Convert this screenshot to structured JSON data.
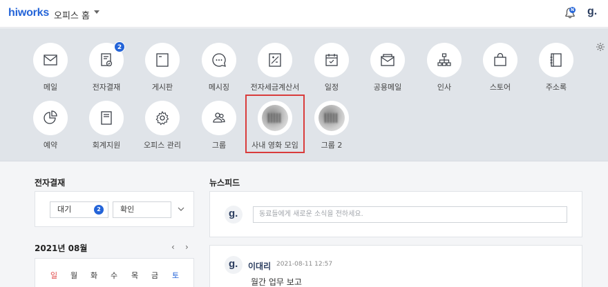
{
  "header": {
    "logo": "hiworks",
    "home_title": "오피스 홈",
    "bell_badge": "N",
    "user_logo": "g."
  },
  "apps": [
    {
      "label": "메일",
      "icon": "mail-icon"
    },
    {
      "label": "전자결재",
      "icon": "approval-icon",
      "badge": "2"
    },
    {
      "label": "게시판",
      "icon": "board-icon"
    },
    {
      "label": "메시징",
      "icon": "message-icon"
    },
    {
      "label": "전자세금계산서",
      "icon": "tax-invoice-icon"
    },
    {
      "label": "일정",
      "icon": "calendar-icon"
    },
    {
      "label": "공용메일",
      "icon": "shared-mail-icon"
    },
    {
      "label": "인사",
      "icon": "org-chart-icon"
    },
    {
      "label": "스토어",
      "icon": "store-icon"
    },
    {
      "label": "주소록",
      "icon": "address-book-icon"
    },
    {
      "label": "예약",
      "icon": "reservation-icon"
    },
    {
      "label": "회계지원",
      "icon": "accounting-icon"
    },
    {
      "label": "오피스 관리",
      "icon": "gear-icon"
    },
    {
      "label": "그룹",
      "icon": "group-icon"
    },
    {
      "label": "사내 영화 모임",
      "icon": "group-avatar"
    },
    {
      "label": "그룹 2",
      "icon": "group-avatar"
    }
  ],
  "approval": {
    "title": "전자결재",
    "waiting_label": "대기",
    "waiting_count": "2",
    "confirm_label": "확인"
  },
  "calendar": {
    "title": "2021년 08월",
    "prev": "‹",
    "next": "›",
    "weekdays": [
      "일",
      "월",
      "화",
      "수",
      "목",
      "금",
      "토"
    ],
    "sunday_color": "#e04848",
    "saturday_color": "#2464d8"
  },
  "feed": {
    "title": "뉴스피드",
    "placeholder": "동료들에게 새로운 소식을 전하세요.",
    "post": {
      "author": "이대리",
      "time": "2021-08-11 12:57",
      "body": "월간 업무 보고"
    }
  },
  "colors": {
    "accent": "#2464d8",
    "highlight": "#d93b3b"
  }
}
